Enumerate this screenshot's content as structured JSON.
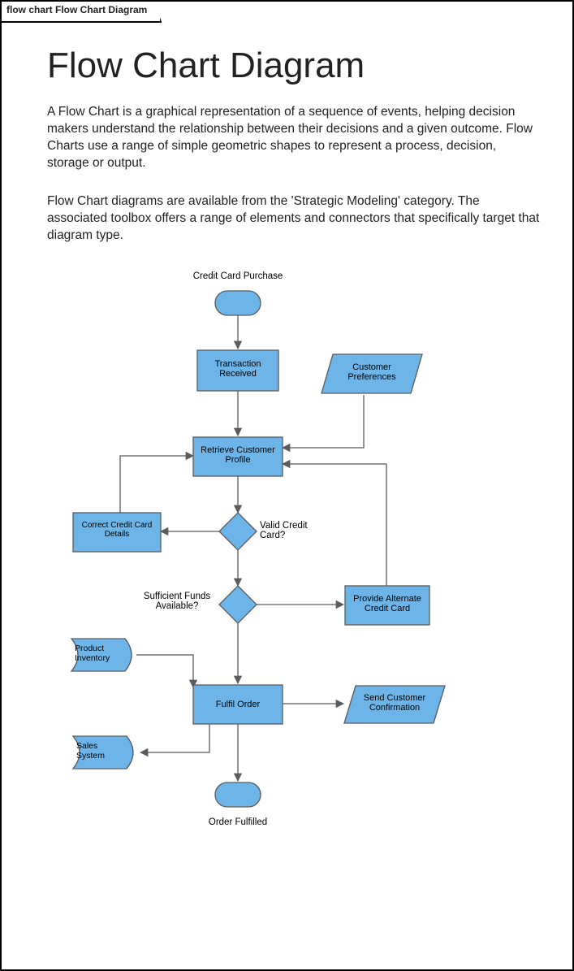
{
  "tab_label": "flow chart Flow Chart Diagram",
  "title": "Flow Chart Diagram",
  "paragraph1": "A Flow Chart is a graphical representation of a sequence of events, helping decision makers understand the relationship between their decisions and a given outcome.  Flow Charts use a range of simple geometric shapes to represent a process, decision, storage or output.",
  "paragraph2": "Flow Chart diagrams are available from the 'Strategic Modeling' category.  The associated toolbox offers a range of elements and connectors that specifically target that diagram type.",
  "labels": {
    "start": "Credit Card Purchase",
    "transaction": "Transaction Received",
    "preferences": "Customer Preferences",
    "retrieve": "Retrieve Customer Profile",
    "correct": "Correct Credit Card Details",
    "validq": "Valid Credit Card?",
    "fundsq": "Sufficient Funds Available?",
    "alternate": "Provide Alternate Credit Card",
    "inventory": "Product Inventory",
    "fulfil": "Fulfil Order",
    "confirm": "Send Customer Confirmation",
    "sales": "Sales System",
    "end": "Order Fulfilled"
  },
  "colors": {
    "fill": "#6db4e8",
    "stroke": "#5b5b5b"
  }
}
